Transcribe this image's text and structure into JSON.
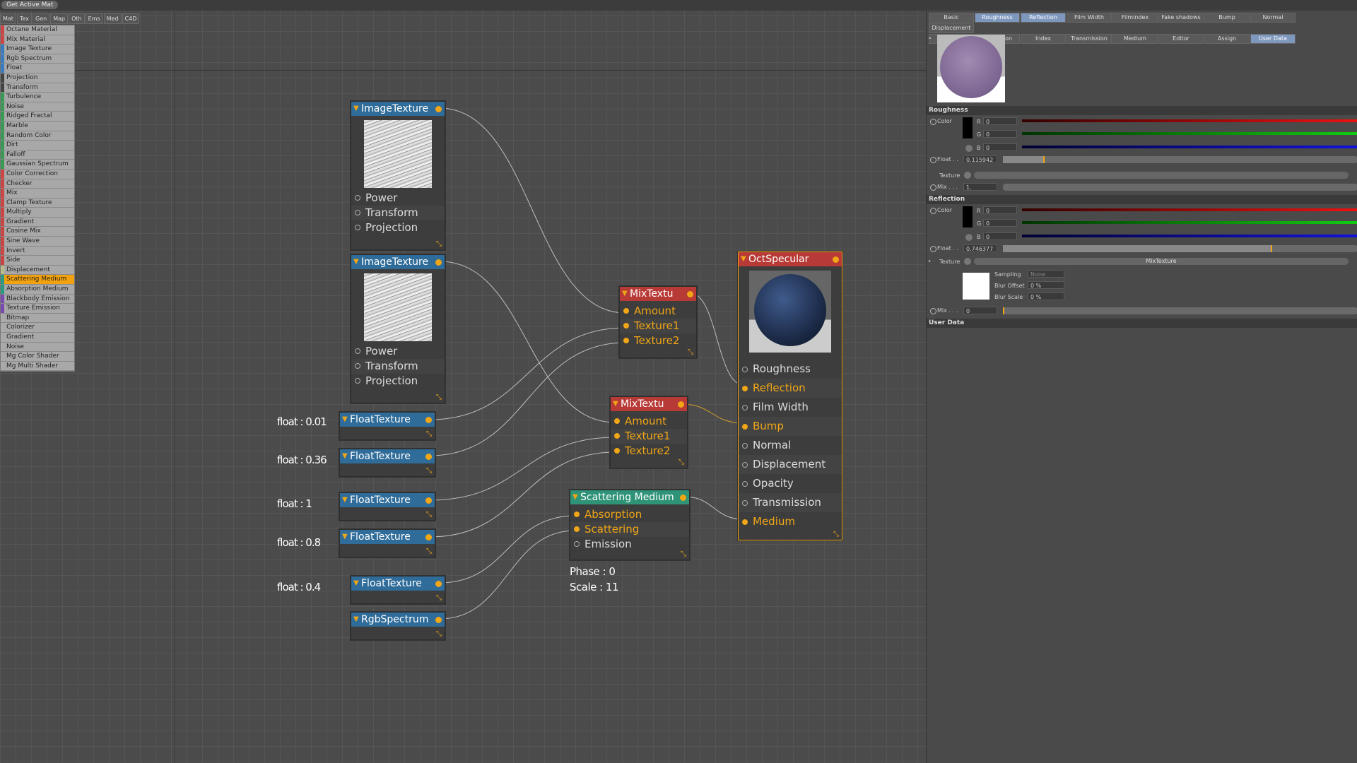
{
  "topbar": {
    "get_active_mat": "Get Active Mat"
  },
  "tabs": [
    "Mat",
    "Tex",
    "Gen",
    "Map",
    "Oth",
    "Ems",
    "Med",
    "C4D"
  ],
  "palette": [
    {
      "label": "Octane Material",
      "color": "#c44"
    },
    {
      "label": "Mix Material",
      "color": "#c44"
    },
    {
      "label": "Image Texture",
      "color": "#3a7bc0"
    },
    {
      "label": "Rgb Spectrum",
      "color": "#3a7bc0"
    },
    {
      "label": "Float",
      "color": "#3a7bc0"
    },
    {
      "label": "Projection",
      "color": "#444"
    },
    {
      "label": "Transform",
      "color": "#444"
    },
    {
      "label": "Turbulence",
      "color": "#3a9a55"
    },
    {
      "label": "Noise",
      "color": "#3a9a55"
    },
    {
      "label": "Ridged Fractal",
      "color": "#3a9a55"
    },
    {
      "label": "Marble",
      "color": "#3a9a55"
    },
    {
      "label": "Random Color",
      "color": "#3a9a55"
    },
    {
      "label": "Dirt",
      "color": "#3a9a55"
    },
    {
      "label": "Falloff",
      "color": "#3a9a55"
    },
    {
      "label": "Gaussian Spectrum",
      "color": "#3a9a55"
    },
    {
      "label": "Color Correction",
      "color": "#c44"
    },
    {
      "label": "Checker",
      "color": "#c44"
    },
    {
      "label": "Mix",
      "color": "#c44"
    },
    {
      "label": "Clamp Texture",
      "color": "#c44"
    },
    {
      "label": "Multiply",
      "color": "#c44"
    },
    {
      "label": "Gradient",
      "color": "#c44"
    },
    {
      "label": "Cosine Mix",
      "color": "#c44"
    },
    {
      "label": "Sine Wave",
      "color": "#c44"
    },
    {
      "label": "Invert",
      "color": "#c44"
    },
    {
      "label": "Side",
      "color": "#c44"
    },
    {
      "label": "Displacement",
      "color": "#bb8"
    },
    {
      "label": "Scattering Medium",
      "color": "#2a9a80",
      "selected": true
    },
    {
      "label": "Absorption Medium",
      "color": "#2a9a80"
    },
    {
      "label": "Blackbody Emission",
      "color": "#7a4ab0"
    },
    {
      "label": "Texture Emission",
      "color": "#7a4ab0"
    },
    {
      "label": "Bitmap",
      "color": "#aaa"
    },
    {
      "label": "Colorizer",
      "color": "#aaa"
    },
    {
      "label": "Gradient",
      "color": "#aaa"
    },
    {
      "label": "Noise",
      "color": "#aaa"
    },
    {
      "label": "Mg Color Shader",
      "color": "#aaa"
    },
    {
      "label": "Mg Multi Shader",
      "color": "#aaa"
    }
  ],
  "nodes": {
    "img1": {
      "title": "ImageTexture",
      "ports": [
        "Power",
        "Transform",
        "Projection"
      ]
    },
    "img2": {
      "title": "ImageTexture",
      "ports": [
        "Power",
        "Transform",
        "Projection"
      ]
    },
    "mix1": {
      "title": "MixTextu",
      "ports": [
        "Amount",
        "Texture1",
        "Texture2"
      ]
    },
    "mix2": {
      "title": "MixTextu",
      "ports": [
        "Amount",
        "Texture1",
        "Texture2"
      ]
    },
    "ft1": {
      "title": "FloatTexture"
    },
    "ft2": {
      "title": "FloatTexture"
    },
    "ft3": {
      "title": "FloatTexture"
    },
    "ft4": {
      "title": "FloatTexture"
    },
    "ft5": {
      "title": "FloatTexture"
    },
    "rgb": {
      "title": "RgbSpectrum"
    },
    "scat": {
      "title": "Scattering Medium",
      "ports": [
        "Absorption",
        "Scattering",
        "Emission"
      ]
    },
    "oct": {
      "title": "OctSpecular",
      "ports": [
        "Roughness",
        "Reflection",
        "Film Width",
        "Bump",
        "Normal",
        "Displacement",
        "Opacity",
        "Transmission",
        "Medium"
      ]
    }
  },
  "float_labels": [
    "float : 0.01",
    "float : 0.36",
    "float : 1",
    "float : 0.8",
    "float : 0.4"
  ],
  "scatter_info": {
    "phase": "Phase : 0",
    "scale": "Scale : 11"
  },
  "panel": {
    "tabs_row1": [
      "Basic",
      "Roughness",
      "Reflection",
      "Film Width",
      "Filmindex",
      "Fake shadows",
      "Bump",
      "Normal",
      "Displacement"
    ],
    "tabs_row2": [
      "Opacity",
      "Dispersion",
      "Index",
      "Transmission",
      "Medium",
      "Editor",
      "Assign",
      "User Data"
    ],
    "roughness": {
      "title": "Roughness",
      "color_label": "Color",
      "r_label": "R",
      "g_label": "G",
      "b_label": "B",
      "r": "0",
      "g": "0",
      "b": "0",
      "float_label": "Float . .",
      "float": "0.115942",
      "texture_label": "Texture",
      "mix_label": "Mix . . .",
      "mix": "1."
    },
    "reflection": {
      "title": "Reflection",
      "color_label": "Color",
      "r_label": "R",
      "g_label": "G",
      "b_label": "B",
      "r": "0",
      "g": "0",
      "b": "0",
      "float_label": "Float . .",
      "float": "0.746377",
      "texture_label": "Texture",
      "texture_name": "MixTexture",
      "sampling_label": "Sampling",
      "sampling": "None",
      "blur_offset_label": "Blur Offset",
      "blur_offset": "0 %",
      "blur_scale_label": "Blur Scale",
      "blur_scale": "0 %",
      "mix_label": "Mix . . .",
      "mix": "0"
    },
    "user_data_title": "User Data"
  }
}
